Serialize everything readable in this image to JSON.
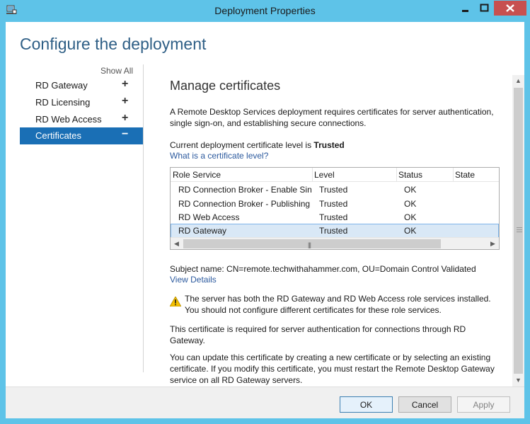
{
  "window": {
    "title": "Deployment Properties"
  },
  "page": {
    "heading": "Configure the deployment",
    "show_all": "Show All"
  },
  "nav": {
    "items": [
      {
        "label": "RD Gateway",
        "sign": "+"
      },
      {
        "label": "RD Licensing",
        "sign": "+"
      },
      {
        "label": "RD Web Access",
        "sign": "+"
      },
      {
        "label": "Certificates",
        "sign": "−",
        "selected": true
      }
    ]
  },
  "content": {
    "section_title": "Manage certificates",
    "intro": "A Remote Desktop Services deployment requires certificates for server authentication, single sign-on, and establishing secure connections.",
    "level_prefix": "Current deployment certificate level is ",
    "level_value": "Trusted",
    "level_link": "What is a certificate level?",
    "table": {
      "headers": [
        "Role Service",
        "Level",
        "Status",
        "State"
      ],
      "rows": [
        {
          "role": "RD Connection Broker - Enable Single Sign On",
          "level": "Trusted",
          "status": "OK",
          "state": ""
        },
        {
          "role": "RD Connection Broker - Publishing",
          "level": "Trusted",
          "status": "OK",
          "state": ""
        },
        {
          "role": "RD Web Access",
          "level": "Trusted",
          "status": "OK",
          "state": ""
        },
        {
          "role": "RD Gateway",
          "level": "Trusted",
          "status": "OK",
          "state": "",
          "selected": true
        }
      ]
    },
    "subject": "Subject name: CN=remote.techwithahammer.com, OU=Domain Control Validated",
    "view_details": "View Details",
    "warning": "The server has both the RD Gateway and RD Web Access role services installed. You should not configure different certificates for these role services.",
    "required_text": "This certificate is required for server authentication for connections through RD Gateway.",
    "update_text": "You can update this certificate by creating a new certificate or by selecting an existing certificate. If you modify this certificate, you must restart the Remote Desktop Gateway service on all RD Gateway servers."
  },
  "buttons": {
    "ok": "OK",
    "cancel": "Cancel",
    "apply": "Apply"
  },
  "colors": {
    "accent": "#1a6fb5",
    "title_bar": "#5ec3e8",
    "heading": "#2f5f86",
    "link": "#2c5a9e",
    "close": "#c75050"
  }
}
